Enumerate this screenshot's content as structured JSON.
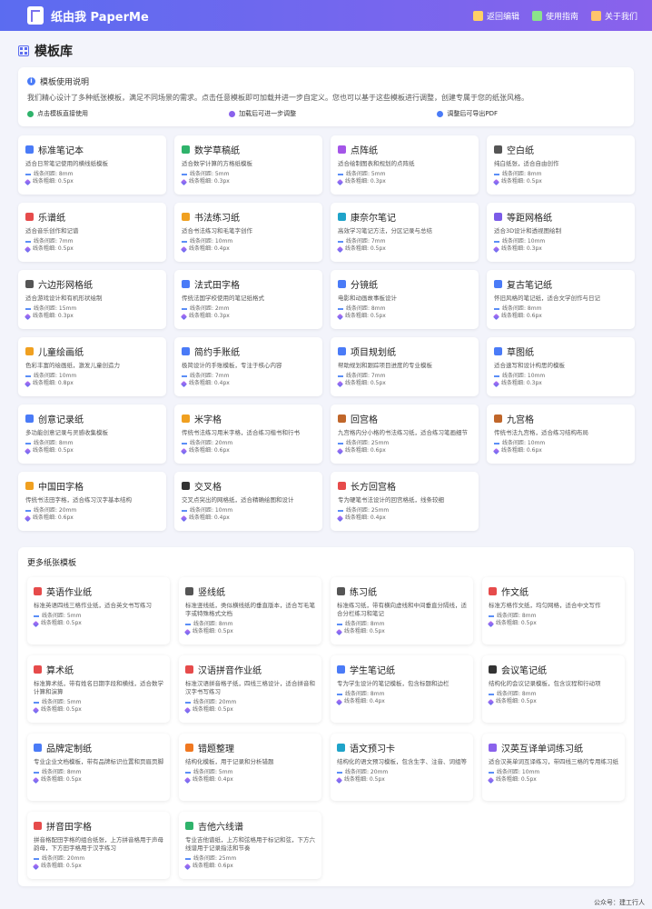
{
  "header": {
    "brand": "纸由我 PaperMe",
    "nav": [
      {
        "label": "返回编辑",
        "icon": "edit-icon",
        "color": "#ffd166"
      },
      {
        "label": "使用指南",
        "icon": "book-icon",
        "color": "#8be38b"
      },
      {
        "label": "关于我们",
        "icon": "users-icon",
        "color": "#ffc46b"
      }
    ]
  },
  "page": {
    "title": "模板库"
  },
  "info": {
    "title": "模板使用说明",
    "desc": "我们精心设计了多种纸张模板，满足不同场景的需求。点击任意模板即可加载并进一步自定义。您也可以基于这些模板进行调整，创建专属于您的纸张风格。",
    "tips": [
      {
        "label": "点击模板直接使用",
        "color": "#2fb36b"
      },
      {
        "label": "加载后可进一步调整",
        "color": "#8a62ec"
      },
      {
        "label": "调整后可导出PDF",
        "color": "#4a7bf7"
      }
    ]
  },
  "templates": [
    {
      "title": "标准笔记本",
      "desc": "适合日常笔记使用的横线纸模板",
      "spacing": "线条间距: 8mm",
      "width": "线条粗细: 0.5px",
      "icon": "lines-icon",
      "color": "#4a7bf7"
    },
    {
      "title": "数学草稿纸",
      "desc": "适合数学计算的方格纸模板",
      "spacing": "线条间距: 5mm",
      "width": "线条粗细: 0.3px",
      "icon": "table-icon",
      "color": "#2fb36b"
    },
    {
      "title": "点阵纸",
      "desc": "适合绘制图表和规划的点阵纸",
      "spacing": "线条间距: 5mm",
      "width": "线条粗细: 0.3px",
      "icon": "dot-circle-icon",
      "color": "#a455e8"
    },
    {
      "title": "空白纸",
      "desc": "纯白纸张，适合自由创作",
      "spacing": "线条间距: 8mm",
      "width": "线条粗细: 0.5px",
      "icon": "square-icon",
      "color": "#555555"
    },
    {
      "title": "乐谱纸",
      "desc": "适合音乐创作和记谱",
      "spacing": "线条间距: 7mm",
      "width": "线条粗细: 0.5px",
      "icon": "music-icon",
      "color": "#e64b4b"
    },
    {
      "title": "书法练习纸",
      "desc": "适合书法练习和毛笔字创作",
      "spacing": "线条间距: 10mm",
      "width": "线条粗细: 0.4px",
      "icon": "brush-icon",
      "color": "#f0a020"
    },
    {
      "title": "康奈尔笔记",
      "desc": "高效学习笔记方法，分区记录与总结",
      "spacing": "线条间距: 7mm",
      "width": "线条粗细: 0.5px",
      "icon": "columns-icon",
      "color": "#1fa3c9"
    },
    {
      "title": "等距网格纸",
      "desc": "适合3D设计和透视图绘制",
      "spacing": "线条间距: 10mm",
      "width": "线条粗细: 0.3px",
      "icon": "cube-icon",
      "color": "#7b5be8"
    },
    {
      "title": "六边形网格纸",
      "desc": "适合游戏设计和有机形状绘制",
      "spacing": "线条间距: 15mm",
      "width": "线条粗细: 0.3px",
      "icon": "hexagon-icon",
      "color": "#555555"
    },
    {
      "title": "法式田字格",
      "desc": "传统法国学校使用的笔记纸格式",
      "spacing": "线条间距: 2mm",
      "width": "线条粗细: 0.3px",
      "icon": "file-icon",
      "color": "#4a7bf7"
    },
    {
      "title": "分镜纸",
      "desc": "电影和动画故事板设计",
      "spacing": "线条间距: 8mm",
      "width": "线条粗细: 0.5px",
      "icon": "file-icon",
      "color": "#4a7bf7"
    },
    {
      "title": "复古笔记纸",
      "desc": "怀旧风格的笔记纸，适合文学创作与日记",
      "spacing": "线条间距: 8mm",
      "width": "线条粗细: 0.6px",
      "icon": "file-icon",
      "color": "#4a7bf7"
    },
    {
      "title": "儿童绘画纸",
      "desc": "色彩丰富的绘画纸，激发儿童创造力",
      "spacing": "线条间距: 10mm",
      "width": "线条粗细: 0.8px",
      "icon": "pencil-icon",
      "color": "#f0a020"
    },
    {
      "title": "简约手账纸",
      "desc": "极简设计的手账模板，专注于核心内容",
      "spacing": "线条间距: 7mm",
      "width": "线条粗细: 0.4px",
      "icon": "file-icon",
      "color": "#4a7bf7"
    },
    {
      "title": "项目规划纸",
      "desc": "帮助规划和跟踪项目进度的专业模板",
      "spacing": "线条间距: 7mm",
      "width": "线条粗细: 0.5px",
      "icon": "file-icon",
      "color": "#4a7bf7"
    },
    {
      "title": "草图纸",
      "desc": "适合速写和设计构思的模板",
      "spacing": "线条间距: 10mm",
      "width": "线条粗细: 0.3px",
      "icon": "file-icon",
      "color": "#4a7bf7"
    },
    {
      "title": "创意记录纸",
      "desc": "多功能创意记录与灵感收集模板",
      "spacing": "线条间距: 8mm",
      "width": "线条粗细: 0.5px",
      "icon": "file-icon",
      "color": "#4a7bf7"
    },
    {
      "title": "米字格",
      "desc": "传统书法练习用米字格，适合练习楷书和行书",
      "spacing": "线条间距: 20mm",
      "width": "线条粗细: 0.6px",
      "icon": "asterisk-icon",
      "color": "#f0a020"
    },
    {
      "title": "回宫格",
      "desc": "九宫格内分小格的书法练习纸，适合练习笔画细节",
      "spacing": "线条间距: 25mm",
      "width": "线条粗细: 0.6px",
      "icon": "grid-icon",
      "color": "#c0662a"
    },
    {
      "title": "九宫格",
      "desc": "传统书法九宫格，适合练习结构布局",
      "spacing": "线条间距: 10mm",
      "width": "线条粗细: 0.6px",
      "icon": "grid-icon",
      "color": "#c0662a"
    },
    {
      "title": "中国田字格",
      "desc": "传统书法田字格，适合练习汉字基本结构",
      "spacing": "线条间距: 20mm",
      "width": "线条粗细: 0.6px",
      "icon": "plus-square-icon",
      "color": "#f0a020"
    },
    {
      "title": "交叉格",
      "desc": "交叉点突出的网格纸，适合精确绘图和设计",
      "spacing": "线条间距: 10mm",
      "width": "线条粗细: 0.4px",
      "icon": "plus-icon",
      "color": "#333333"
    },
    {
      "title": "长方回宫格",
      "desc": "专为硬笔书法设计的回宫格纸，线条较细",
      "spacing": "线条间距: 25mm",
      "width": "线条粗细: 0.4px",
      "icon": "pen-icon",
      "color": "#e64b4b"
    }
  ],
  "more": {
    "title": "更多纸张模板",
    "items": [
      {
        "title": "英语作业纸",
        "desc": "标准英语四线三格作业纸，适合英文书写练习",
        "spacing": "线条间距: 5mm",
        "width": "线条粗细: 0.5px",
        "icon": "pen-icon",
        "color": "#e64b4b"
      },
      {
        "title": "竖线纸",
        "desc": "标准竖线纸，类似横线纸的垂直版本，适合写毛笔字或特殊格式文档",
        "spacing": "线条间距: 8mm",
        "width": "线条粗细: 0.5px",
        "icon": "bars-icon",
        "color": "#555555"
      },
      {
        "title": "练习纸",
        "desc": "标准练习纸，带有横向虚线和中间垂直分隔线，适合分栏练习和笔记",
        "spacing": "线条间距: 8mm",
        "width": "线条粗细: 0.5px",
        "icon": "list-icon",
        "color": "#555555"
      },
      {
        "title": "作文纸",
        "desc": "标准方格作文纸，均匀网格，适合中文写作",
        "spacing": "线条间距: 8mm",
        "width": "线条粗细: 0.5px",
        "icon": "file-alt-icon",
        "color": "#e64b4b"
      },
      {
        "title": "算术纸",
        "desc": "标准算术纸，带有姓名日期字段和横线，适合数学计算和演算",
        "spacing": "线条间距: 5mm",
        "width": "线条粗细: 0.5px",
        "icon": "calculator-icon",
        "color": "#e64b4b"
      },
      {
        "title": "汉语拼音作业纸",
        "desc": "标准汉语拼音格子纸，四线三格设计，适合拼音和汉字书写练习",
        "spacing": "线条间距: 20mm",
        "width": "线条粗细: 0.5px",
        "icon": "language-icon",
        "color": "#e64b4b"
      },
      {
        "title": "学生笔记纸",
        "desc": "专为学生设计的笔记模板，包含标题和边栏",
        "spacing": "线条间距: 8mm",
        "width": "线条粗细: 0.4px",
        "icon": "file-icon",
        "color": "#4a7bf7"
      },
      {
        "title": "会议笔记纸",
        "desc": "结构化的会议记录模板，包含议程和行动项",
        "spacing": "线条间距: 8mm",
        "width": "线条粗细: 0.5px",
        "icon": "briefcase-icon",
        "color": "#333333"
      },
      {
        "title": "品牌定制纸",
        "desc": "专业企业文档模板，带有品牌标识位置和页眉页脚",
        "spacing": "线条间距: 8mm",
        "width": "线条粗细: 0.5px",
        "icon": "building-icon",
        "color": "#4a7bf7"
      },
      {
        "title": "错题整理",
        "desc": "结构化模板，用于记录和分析错题",
        "spacing": "线条间距: 5mm",
        "width": "线条粗细: 0.4px",
        "icon": "warning-icon",
        "color": "#f07820"
      },
      {
        "title": "语文预习卡",
        "desc": "结构化的语文预习模板，包含生字、注音、词组等",
        "spacing": "线条间距: 20mm",
        "width": "线条粗细: 0.5px",
        "icon": "reader-icon",
        "color": "#1fa3c9"
      },
      {
        "title": "汉英互译单词练习纸",
        "desc": "适合汉英单词互译练习，带四线三格的专用练习纸",
        "spacing": "线条间距: 10mm",
        "width": "线条粗细: 0.5px",
        "icon": "language-icon",
        "color": "#8a62ec"
      },
      {
        "title": "拼音田字格",
        "desc": "拼音格配田字格的组合纸张，上方拼音格用于声母韵母，下方田字格用于汉字练习",
        "spacing": "线条间距: 20mm",
        "width": "线条粗细: 0.5px",
        "icon": "grid-icon",
        "color": "#e64b4b"
      },
      {
        "title": "吉他六线谱",
        "desc": "专业吉他谱纸，上方和弦格用于标记和弦，下方六线谱用于记录指法和节奏",
        "spacing": "线条间距: 25mm",
        "width": "线条粗细: 0.6px",
        "icon": "music-icon",
        "color": "#2fb36b"
      }
    ]
  },
  "footer": {
    "text": "公众号：建工行人"
  }
}
